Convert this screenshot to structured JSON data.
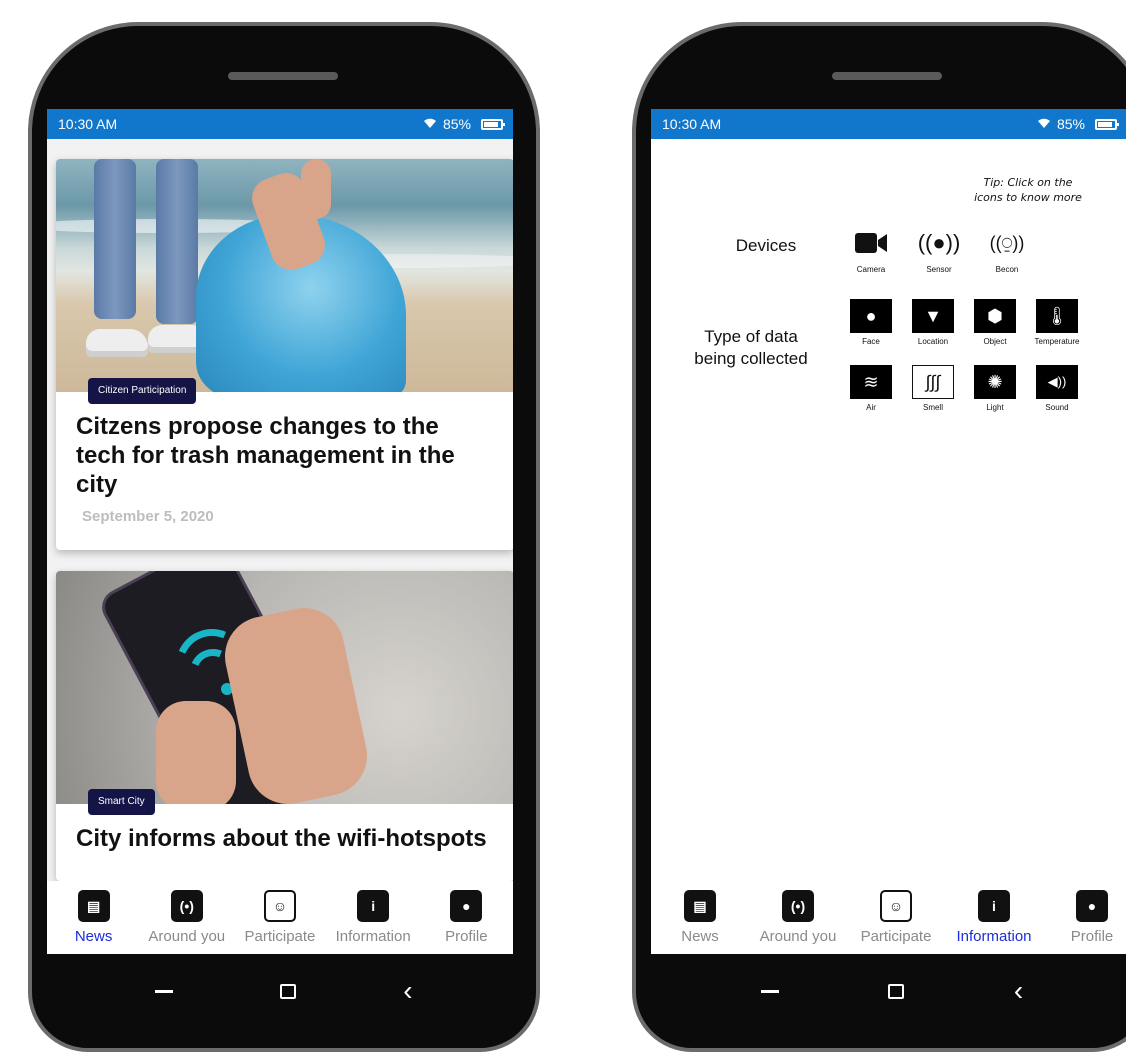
{
  "status": {
    "time": "10:30 AM",
    "battery": "85%"
  },
  "feed": {
    "articles": [
      {
        "tag": "Citizen Participation",
        "title": "Citzens propose changes to the tech for trash management in the city",
        "date": "September 5, 2020"
      },
      {
        "tag": "Smart City",
        "title": "City informs about the wifi-hotspots"
      }
    ]
  },
  "nav": {
    "items": [
      {
        "label": "News",
        "icon": "newspaper-icon"
      },
      {
        "label": "Around you",
        "icon": "broadcast-icon"
      },
      {
        "label": "Participate",
        "icon": "people-icon"
      },
      {
        "label": "Information",
        "icon": "info-icon"
      },
      {
        "label": "Profile",
        "icon": "person-icon"
      }
    ],
    "active_left": "News",
    "active_right": "Information",
    "active_color": "#1d2dd9"
  },
  "info": {
    "tip": "Tip: Click on the icons to know more",
    "devices_label": "Devices",
    "data_label": "Type of data being collected",
    "devices": [
      {
        "caption": "Camera",
        "icon": "video-camera-icon"
      },
      {
        "caption": "Sensor",
        "icon": "sensor-icon"
      },
      {
        "caption": "Becon",
        "icon": "beacon-icon"
      }
    ],
    "data_types": [
      {
        "caption": "Face",
        "icon": "face-icon"
      },
      {
        "caption": "Location",
        "icon": "location-pin-icon"
      },
      {
        "caption": "Object",
        "icon": "hexagon-icon"
      },
      {
        "caption": "Temperature",
        "icon": "thermometer-icon"
      },
      {
        "caption": "Air",
        "icon": "wind-icon"
      },
      {
        "caption": "Smell",
        "icon": "smell-icon"
      },
      {
        "caption": "Light",
        "icon": "sun-icon"
      },
      {
        "caption": "Sound",
        "icon": "speaker-icon"
      }
    ]
  },
  "colors": {
    "statusbar": "#1177cc",
    "tag_bg": "#141447"
  }
}
